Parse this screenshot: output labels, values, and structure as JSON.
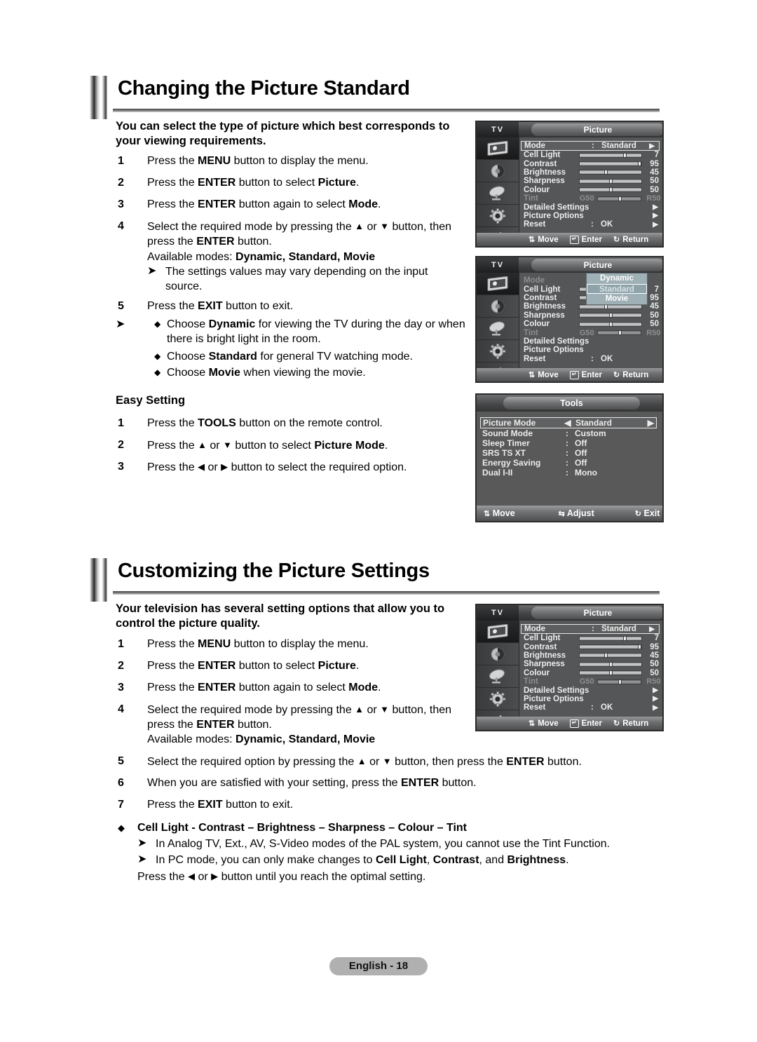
{
  "sections": [
    {
      "title": "Changing the Picture Standard",
      "intro": "You can select the type of picture which best corresponds to your viewing requirements.",
      "steps": [
        {
          "num": "1",
          "text": "Press the MENU button to display the menu."
        },
        {
          "num": "2",
          "text": "Press the ENTER button to select Picture."
        },
        {
          "num": "3",
          "text": "Press the ENTER button again to select Mode."
        },
        {
          "num": "4",
          "text": "Select the required mode by pressing the ▲ or ▼ button, then press the ENTER button."
        },
        {
          "num": "5",
          "text": "Press the EXIT button to exit."
        }
      ],
      "available_modes_label": "Available modes:",
      "available_modes": "Dynamic, Standard, Movie",
      "note_source": "The settings values may vary depending on the input source.",
      "bullets": [
        "Choose Dynamic for viewing the TV during the day or when there is bright light in the room.",
        "Choose Standard for general TV watching mode.",
        "Choose Movie when viewing the movie."
      ],
      "easy_setting_title": "Easy Setting",
      "easy_steps": [
        {
          "num": "1",
          "text": "Press the TOOLS button on the remote control."
        },
        {
          "num": "2",
          "text": "Press the ▲ or ▼ button to select Picture Mode."
        },
        {
          "num": "3",
          "text": "Press the ◄ or ► button to select the required option."
        }
      ]
    },
    {
      "title": "Customizing the Picture Settings",
      "intro": "Your television has several setting options that allow you to control the picture quality.",
      "steps": [
        {
          "num": "1",
          "text": "Press the MENU button to display the menu."
        },
        {
          "num": "2",
          "text": "Press the ENTER button to select Picture."
        },
        {
          "num": "3",
          "text": "Press the ENTER button again to select Mode."
        },
        {
          "num": "4",
          "text": "Select the required mode by pressing the ▲ or ▼ button, then press the ENTER button."
        },
        {
          "num": "5",
          "text": "Select the required option by pressing the ▲ or ▼ button, then press the ENTER button."
        },
        {
          "num": "6",
          "text": "When you are satisfied with your setting, press the ENTER button."
        },
        {
          "num": "7",
          "text": "Press the EXIT button to exit."
        }
      ],
      "available_modes_label": "Available modes:",
      "available_modes": "Dynamic, Standard, Movie",
      "bullet_heading": "Cell Light - Contrast – Brightness – Sharpness – Colour – Tint",
      "notes": [
        "In Analog TV, Ext., AV, S-Video modes of the PAL system, you cannot use the Tint Function.",
        "In PC mode, you can only make changes to Cell Light, Contrast, and Brightness.",
        "Press the ◄ or ► button until you reach the optimal setting."
      ]
    }
  ],
  "osd": {
    "tv_label": "TV",
    "title": "Picture",
    "icons": [
      "picture-icon",
      "sound-icon",
      "channel-icon",
      "setup-icon",
      "input-icon"
    ],
    "rows": [
      {
        "label": "Mode",
        "colon": ":",
        "value": "Standard",
        "type": "select",
        "selected": true
      },
      {
        "label": "Cell Light",
        "type": "slider",
        "value": "7",
        "pct": 70
      },
      {
        "label": "Contrast",
        "type": "slider",
        "value": "95",
        "pct": 95
      },
      {
        "label": "Brightness",
        "type": "slider",
        "value": "45",
        "pct": 45
      },
      {
        "label": "Sharpness",
        "type": "slider",
        "value": "50",
        "pct": 50
      },
      {
        "label": "Colour",
        "type": "slider",
        "value": "50",
        "pct": 50
      },
      {
        "label": "Tint",
        "type": "slider-range",
        "left": "G50",
        "right": "R50",
        "pct": 50,
        "dim": true
      },
      {
        "label": "Detailed Settings",
        "type": "submenu"
      },
      {
        "label": "Picture Options",
        "type": "submenu"
      },
      {
        "label": "Reset",
        "colon": ":",
        "value": "OK",
        "type": "submenu-value"
      }
    ],
    "footer": [
      {
        "icon": "updown-arrow-icon",
        "label": "Move"
      },
      {
        "icon": "enter-key-icon",
        "label": "Enter"
      },
      {
        "icon": "return-arrow-icon",
        "label": "Return"
      }
    ],
    "dropdown": {
      "options": [
        "Dynamic",
        "Standard",
        "Movie"
      ],
      "selected": "Standard"
    }
  },
  "tools": {
    "title": "Tools",
    "rows": [
      {
        "label": "Picture Mode",
        "value": "Standard",
        "selected": true
      },
      {
        "label": "Sound Mode",
        "colon": ":",
        "value": "Custom"
      },
      {
        "label": "Sleep Timer",
        "colon": ":",
        "value": "Off"
      },
      {
        "label": "SRS TS XT",
        "colon": ":",
        "value": "Off"
      },
      {
        "label": "Energy Saving",
        "colon": ":",
        "value": "Off"
      },
      {
        "label": "Dual I-II",
        "colon": ":",
        "value": "Mono"
      }
    ],
    "footer": [
      {
        "icon": "updown-arrow-icon",
        "label": "Move"
      },
      {
        "icon": "leftright-arrow-icon",
        "label": "Adjust"
      },
      {
        "icon": "return-arrow-icon",
        "label": "Exit"
      }
    ]
  },
  "footer": {
    "page_label": "English - 18"
  }
}
